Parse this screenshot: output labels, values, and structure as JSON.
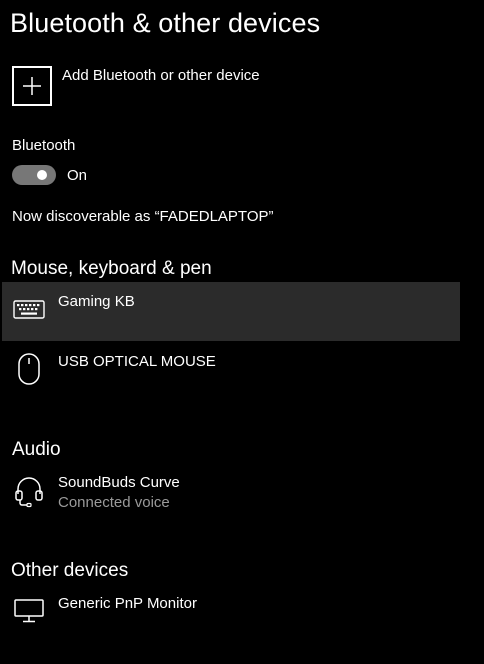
{
  "page": {
    "title": "Bluetooth & other devices"
  },
  "add_device": {
    "label": "Add Bluetooth or other device",
    "icon": "plus-icon"
  },
  "bluetooth": {
    "label": "Bluetooth",
    "toggle_on": true,
    "state_text": "On",
    "discoverable_text": "Now discoverable as “FADEDLAPTOP”"
  },
  "sections": {
    "mouse_keyboard_pen": {
      "title": "Mouse, keyboard & pen",
      "devices": [
        {
          "name": "Gaming KB",
          "icon": "keyboard-icon",
          "selected": true
        },
        {
          "name": "USB OPTICAL MOUSE",
          "icon": "mouse-icon",
          "selected": false
        }
      ]
    },
    "audio": {
      "title": "Audio",
      "devices": [
        {
          "name": "SoundBuds Curve",
          "status": "Connected voice",
          "icon": "headset-icon"
        }
      ]
    },
    "other_devices": {
      "title": "Other devices",
      "devices": [
        {
          "name": "Generic PnP Monitor",
          "icon": "monitor-icon"
        }
      ]
    }
  },
  "colors": {
    "background": "#000000",
    "text": "#ffffff",
    "secondary_text": "#9a9a9a",
    "selected_row": "#2b2b2b",
    "toggle_track": "#777777"
  }
}
